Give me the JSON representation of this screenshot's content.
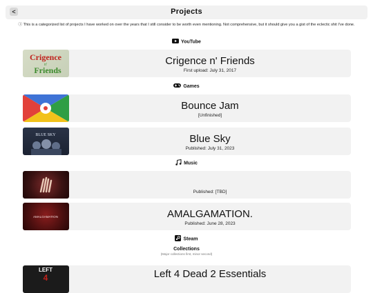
{
  "header": {
    "back_label": "<",
    "title": "Projects"
  },
  "intro": "This is a categorized list of projects I have worked on over the years that I still consider to be worth even mentioning. Not comprehensive, but it should give you a gist of the eclectic shit I've done.",
  "sections": {
    "youtube": "YouTube",
    "games": "Games",
    "music": "Music",
    "steam": "Steam"
  },
  "cards": {
    "crigence": {
      "thumb_text_1": "Crigence",
      "thumb_text_2": "n'",
      "thumb_text_3": "Friends",
      "title": "Crigence n' Friends",
      "sub": "First upload: July 31, 2017"
    },
    "bounce": {
      "title": "Bounce Jam",
      "sub": "[Unfinished]"
    },
    "bluesky": {
      "thumb_text": "BLUE SKY",
      "title": "Blue Sky",
      "sub": "Published: July 31, 2023"
    },
    "music1": {
      "title": "",
      "sub": "Published: [TBD]"
    },
    "amalgam": {
      "thumb_text": "AMALGAMATION",
      "title": "AMALGAMATION.",
      "sub": "Published: June 28, 2023"
    },
    "l4d2": {
      "thumb_text_1": "LEFT",
      "thumb_text_2": "4",
      "title": "Left 4 Dead 2 Essentials"
    }
  },
  "steam": {
    "collections_title": "Collections",
    "collections_note": "(Major collections first, minor second)"
  }
}
